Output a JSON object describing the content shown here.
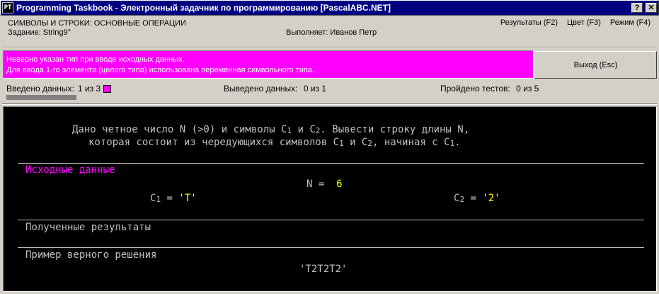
{
  "window": {
    "title": "Programming Taskbook - Электронный задачник по программированию [PascalABC.NET]",
    "help_label": "?",
    "close_label": "✕"
  },
  "header": {
    "group": "СИМВОЛЫ И СТРОКИ: ОСНОВНЫЕ ОПЕРАЦИИ",
    "task": "Задание: String9°",
    "student": "Выполняет: Иванов Петр",
    "menu": [
      "Результаты (F2)",
      "Цвет (F3)",
      "Режим (F4)"
    ]
  },
  "error": {
    "line1": "Неверно указан тип при вводе исходных данных.",
    "line2": "Для ввода 1-го элемента (целого типа) использована переменная символьного типа.",
    "color": "#ff00ff"
  },
  "exit_label": "Выход (Esc)",
  "status": {
    "input_label": "Введено данных:",
    "input_value": "1 из 3",
    "output_label": "Выведено данных:",
    "output_value": "0 из 1",
    "tests_label": "Пройдено тестов:",
    "tests_value": "0 из 5"
  },
  "console": {
    "desc1_a": "Дано четное число N (>0) и символы C",
    "desc1_b": " и C",
    "desc1_c": ". Вывести строку длины N,",
    "desc2_a": "которая состоит из чередующихся символов C",
    "desc2_b": " и C",
    "desc2_c": ", начиная с C",
    "desc2_d": ".",
    "sub1": "1",
    "sub2": "2",
    "input_header": "Исходные данные",
    "n_label": "N =",
    "n_value": "6",
    "c1_label": "C",
    "c1_eq": " = ",
    "c1_value": "'T'",
    "c2_label": "C",
    "c2_eq": " = ",
    "c2_value": "'2'",
    "results_header": "Полученные результаты",
    "example_header": "Пример верного решения",
    "example_value": "'T2T2T2'"
  }
}
